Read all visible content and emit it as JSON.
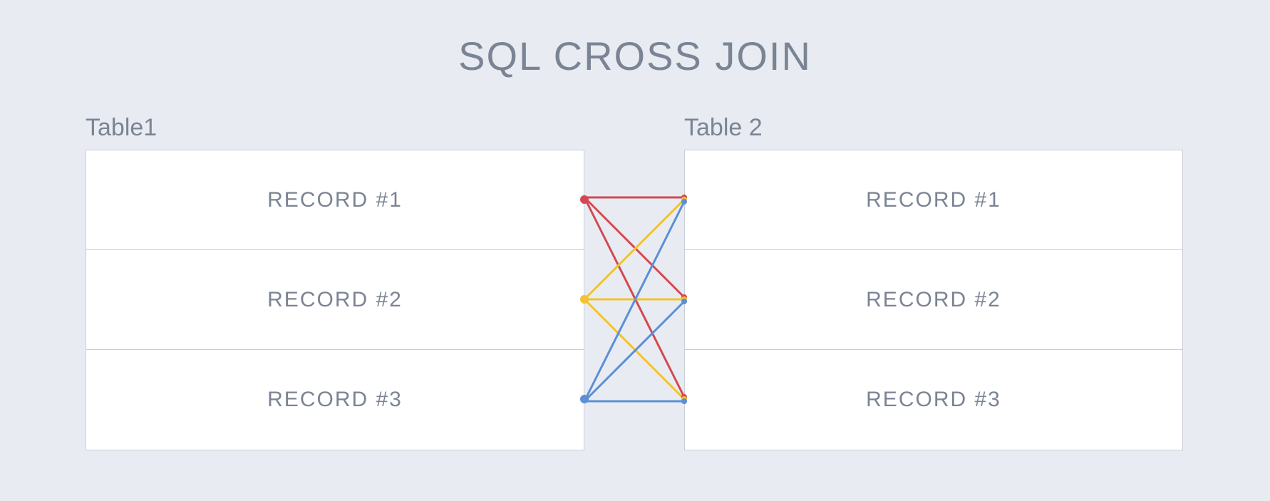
{
  "title": "SQL CROSS JOIN",
  "tables": {
    "left": {
      "label": "Table1",
      "rows": [
        "RECORD #1",
        "RECORD #2",
        "RECORD #3"
      ]
    },
    "right": {
      "label": "Table 2",
      "rows": [
        "RECORD #1",
        "RECORD #2",
        "RECORD #3"
      ]
    }
  },
  "join": {
    "type": "cross",
    "colors": {
      "source0": "#d14a52",
      "source1": "#f1c232",
      "source2": "#5b8fd6"
    },
    "links": [
      {
        "from": 0,
        "to": 0,
        "color": "source0"
      },
      {
        "from": 0,
        "to": 1,
        "color": "source0"
      },
      {
        "from": 0,
        "to": 2,
        "color": "source0"
      },
      {
        "from": 1,
        "to": 0,
        "color": "source1"
      },
      {
        "from": 1,
        "to": 1,
        "color": "source1"
      },
      {
        "from": 1,
        "to": 2,
        "color": "source1"
      },
      {
        "from": 2,
        "to": 0,
        "color": "source2"
      },
      {
        "from": 2,
        "to": 1,
        "color": "source2"
      },
      {
        "from": 2,
        "to": 2,
        "color": "source2"
      }
    ]
  }
}
